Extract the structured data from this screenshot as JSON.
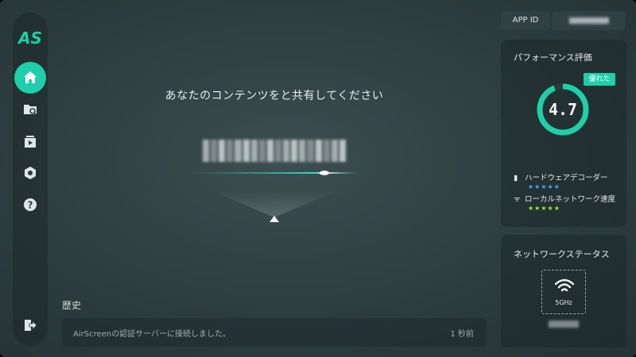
{
  "app": {
    "logo_text": "AS",
    "accent": "#1fcfa9"
  },
  "sidebar": {
    "items": [
      {
        "icon": "home-icon",
        "active": true
      },
      {
        "icon": "folder-search-icon",
        "active": false
      },
      {
        "icon": "media-library-icon",
        "active": false
      },
      {
        "icon": "settings-hex-icon",
        "active": false
      },
      {
        "icon": "help-icon",
        "active": false
      }
    ],
    "logout_icon": "logout-icon"
  },
  "main": {
    "share_title": "あなたのコンテンツをと共有してください",
    "connection_code": "(blurred)"
  },
  "history": {
    "title": "歴史",
    "entries": [
      {
        "message": "AirScreenの認証サーバーに接続しました。",
        "time": "1 秒前"
      }
    ]
  },
  "app_id": {
    "label": "APP ID"
  },
  "performance": {
    "title": "パフォーマンス評価",
    "badge": "優れた",
    "score": "4.7",
    "score_fraction": 0.94,
    "metrics": [
      {
        "label": "ハードウェアデコーダー",
        "icon": "chip-icon",
        "stars": "★★★★★",
        "rating": 4.5,
        "color": "#3ea8ff"
      },
      {
        "label": "ローカルネットワーク速度",
        "icon": "wifi-icon",
        "stars": "★★★★★",
        "rating": 5,
        "color": "#a5e83c"
      }
    ]
  },
  "network": {
    "title": "ネットワークステータス",
    "band": "5GHz"
  }
}
